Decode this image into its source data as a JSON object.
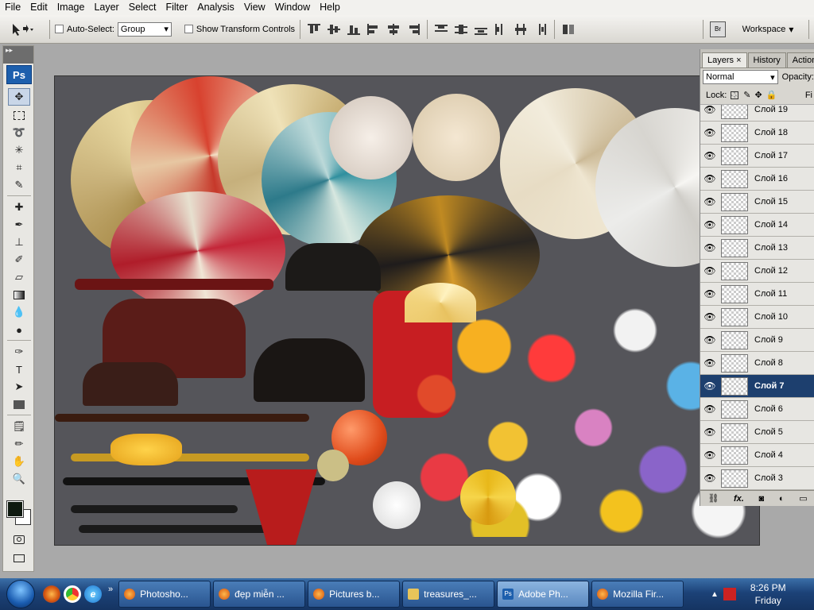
{
  "menu": [
    "File",
    "Edit",
    "Image",
    "Layer",
    "Select",
    "Filter",
    "Analysis",
    "View",
    "Window",
    "Help"
  ],
  "options": {
    "auto_select_label": "Auto-Select:",
    "auto_select_value": "Group",
    "transform_label": "Show Transform Controls",
    "workspace_label": "Workspace"
  },
  "toolbox": {
    "badge": "Ps"
  },
  "panel": {
    "tabs": [
      "Layers",
      "History",
      "Actions"
    ],
    "blend_mode": "Normal",
    "opacity_label": "Opacity:",
    "lock_label": "Lock:",
    "fill_label": "Fi",
    "layers": [
      "Слой 19",
      "Слой 18",
      "Слой 17",
      "Слой 16",
      "Слой 15",
      "Слой 14",
      "Слой 13",
      "Слой 12",
      "Слой 11",
      "Слой 10",
      "Слой 9",
      "Слой 8",
      "Слой 7",
      "Слой 6",
      "Слой 5",
      "Слой 4",
      "Слой 3"
    ],
    "selected": "Слой 7",
    "footer_fx": "fx."
  },
  "taskbar": {
    "tasks": [
      "Photosho...",
      "đẹp miễn ...",
      "Pictures b...",
      "treasures_...",
      "Adobe Ph...",
      "Mozilla Fir..."
    ],
    "active": "Adobe Ph...",
    "time": "8:26 PM",
    "day": "Friday"
  },
  "colors": {
    "selection": "#1d3f6e",
    "taskbar": "#1c4278",
    "canvas": "#55555a"
  }
}
